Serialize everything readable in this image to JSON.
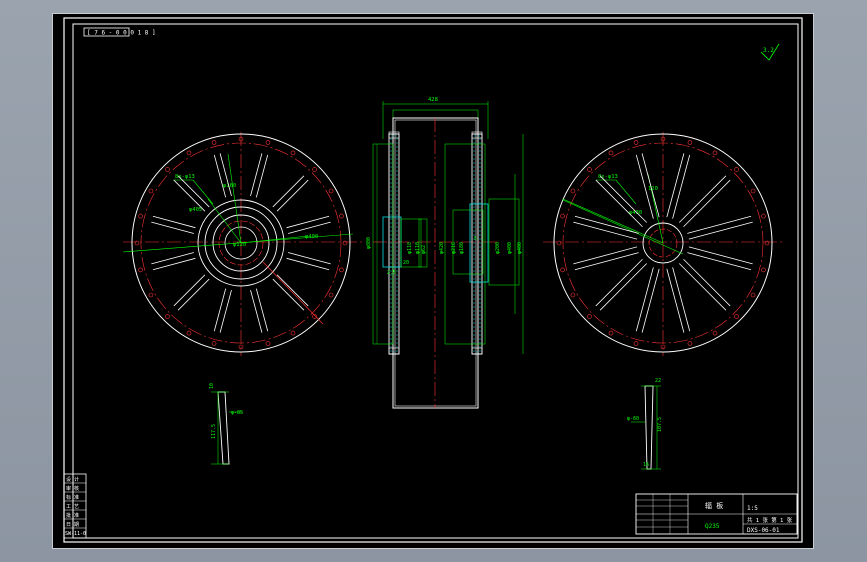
{
  "app": {
    "name": "CAD drawing viewer"
  },
  "colors": {
    "background": "#000000",
    "frame": "#ffffff",
    "outline": "#ffffff",
    "dimension": "#00ff00",
    "centerline": "#ff3333",
    "hatch": "#00e5e5"
  },
  "drawing": {
    "view_code": "[ 7 6 - 0 0 0 1 8 ]",
    "roughness_mark": "3.2",
    "left_view": {
      "bolt_callout": "8x-φ13",
      "dim_a": "φ405",
      "dim_b": "φ160",
      "dim_c": "φ120",
      "dim_d": "φ400"
    },
    "section_view": {
      "overall_width": "428",
      "left_labels": [
        "φ800",
        "φ118",
        "φ110",
        "φ62",
        "20",
        "2.5"
      ],
      "right_labels": [
        "φ420",
        "φ216",
        "φ180",
        "φ200",
        "φ400",
        "φ400",
        "5"
      ]
    },
    "right_view": {
      "bolt_callout": "8x-φ13",
      "dim_a": "φ430",
      "dim_b": "120"
    },
    "left_detail": {
      "labels": [
        "10",
        "φ-85",
        "117.5"
      ]
    },
    "right_detail": {
      "labels": [
        "22",
        "φ-60",
        "107.5",
        "16"
      ]
    },
    "left_revision_block": {
      "rows": [
        "设 计",
        "审 核",
        "标 准",
        "工 艺",
        "批 准",
        "日 期",
        "SW-11-0"
      ]
    },
    "title_block": {
      "part_name": "辐 板",
      "material": "Q235",
      "drawing_number": "DXS-06-01",
      "scale": "1:5",
      "sheet_info": "共 1 张 第 1 张"
    }
  }
}
